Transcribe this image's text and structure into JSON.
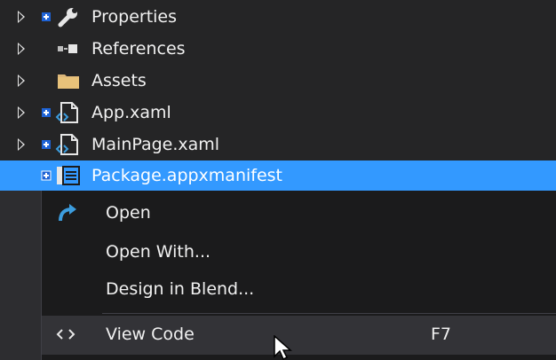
{
  "tree": {
    "items": [
      {
        "label": "Properties",
        "icon": "wrench-icon"
      },
      {
        "label": "References",
        "icon": "references-icon"
      },
      {
        "label": "Assets",
        "icon": "folder-icon"
      },
      {
        "label": "App.xaml",
        "icon": "xaml-file-icon"
      },
      {
        "label": "MainPage.xaml",
        "icon": "xaml-file-icon"
      },
      {
        "label": "Package.appxmanifest",
        "icon": "manifest-file-icon",
        "selected": true
      }
    ]
  },
  "context_menu": {
    "items": [
      {
        "label": "Open",
        "icon": "open-arrow-icon",
        "shortcut": ""
      },
      {
        "label": "Open With...",
        "shortcut": ""
      },
      {
        "label": "Design in Blend...",
        "shortcut": ""
      },
      {
        "label": "View Code",
        "icon": "code-brackets-icon",
        "shortcut": "F7",
        "hover": true
      }
    ]
  },
  "colors": {
    "selection": "#3399ff",
    "menu_background": "#1b1b1c",
    "tree_background": "#252526",
    "accent_blue": "#1e90ff"
  }
}
